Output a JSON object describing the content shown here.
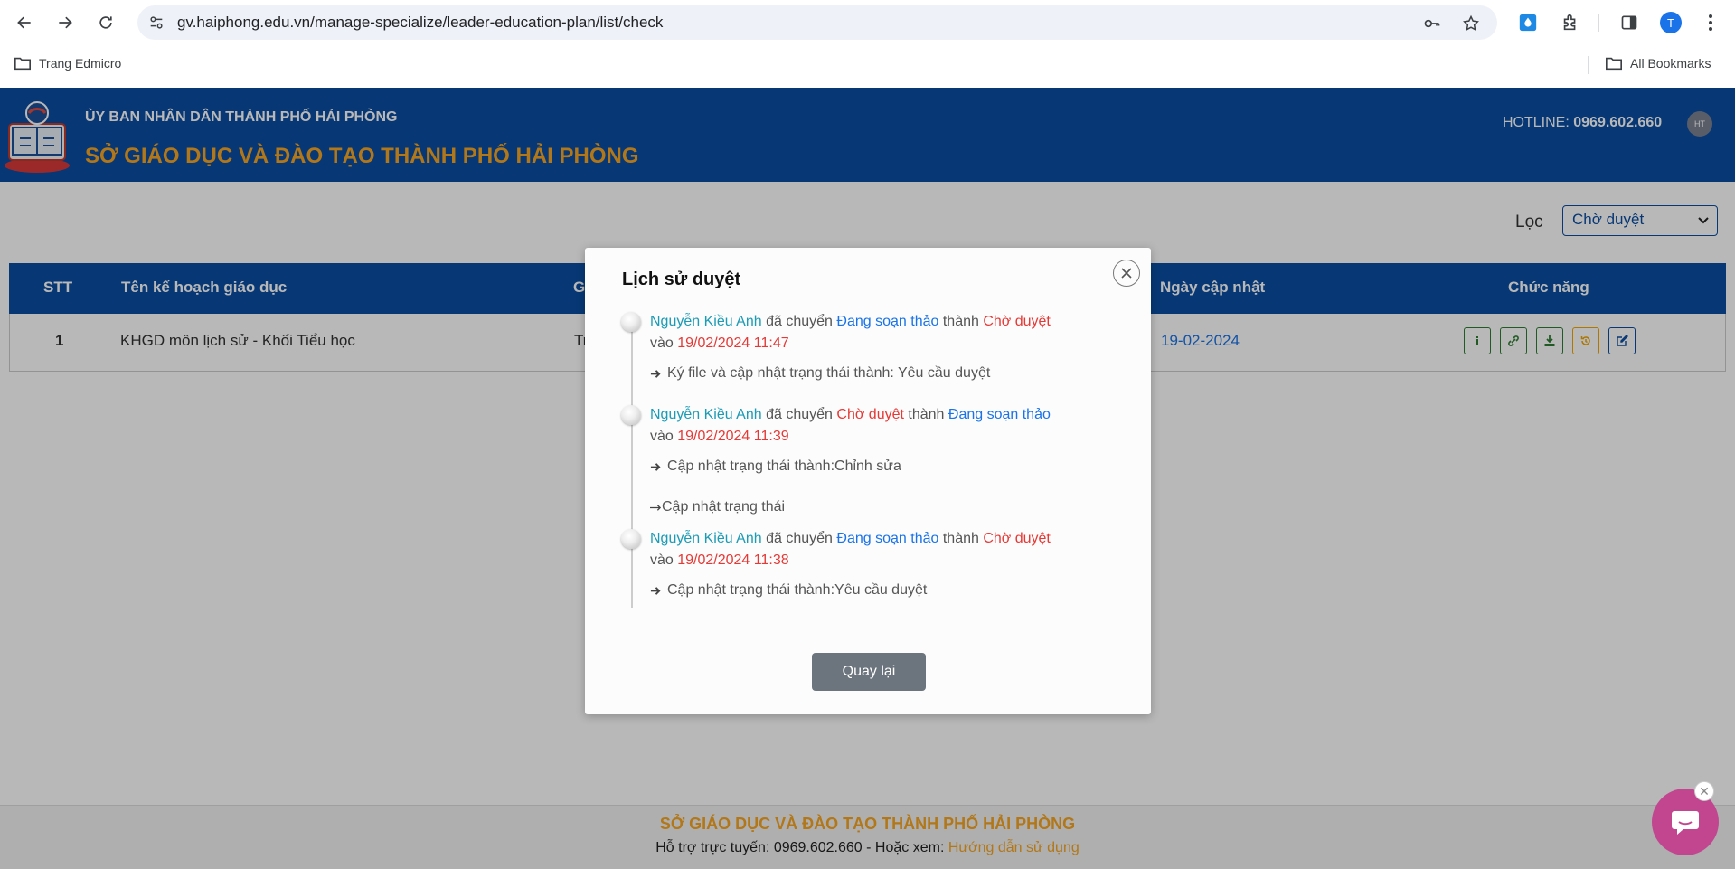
{
  "browser": {
    "url": "gv.haiphong.edu.vn/manage-specialize/leader-education-plan/list/check",
    "profile_initial": "T",
    "bookmarks": [
      {
        "label": "Trang Edmicro"
      }
    ],
    "all_bookmarks_label": "All Bookmarks"
  },
  "header": {
    "line1": "ỦY BAN NHÂN DÂN THÀNH PHỐ HẢI PHÒNG",
    "line2": "SỞ GIÁO DỤC VÀ ĐÀO TẠO THÀNH PHỐ HẢI PHÒNG",
    "hotline_label": "HOTLINE:",
    "hotline_number": "0969.602.660",
    "avatar_initials": "HT"
  },
  "filter": {
    "label": "Lọc",
    "selected": "Chờ duyệt"
  },
  "table": {
    "columns": [
      "STT",
      "Tên kế hoạch giáo dục",
      "G",
      "Ngày cập nhật",
      "Chức năng"
    ],
    "rows": [
      {
        "stt": "1",
        "name": "KHGD môn lịch sử - Khối Tiểu học",
        "partial": "Tr",
        "updated": "19-02-2024"
      }
    ]
  },
  "footer": {
    "title": "SỞ GIÁO DỤC VÀ ĐÀO TẠO THÀNH PHỐ HẢI PHÒNG",
    "support_text": "Hỗ trợ trực tuyến: 0969.602.660 - Hoặc xem:",
    "guide_link": "Hướng dẫn sử dụng"
  },
  "modal": {
    "title": "Lịch sử duyệt",
    "entries": [
      {
        "user": "Nguyễn Kiều Anh",
        "verb": "đã chuyển",
        "from": "Đang soạn thảo",
        "mid": "thành",
        "to": "Chờ duyệt",
        "at_label": "vào",
        "time": "19/02/2024 11:47",
        "notes": [
          "Ký file và cập nhật trạng thái thành: Yêu cầu duyệt"
        ]
      },
      {
        "user": "Nguyễn Kiều Anh",
        "verb": "đã chuyển",
        "from": "Chờ duyệt",
        "mid": "thành",
        "to": "Đang soạn thảo",
        "at_label": "vào",
        "time": "19/02/2024 11:39",
        "notes": [
          "Cập nhật trạng thái thành:Chỉnh sửa",
          "Cập nhật trạng thái"
        ]
      },
      {
        "user": "Nguyễn Kiều Anh",
        "verb": "đã chuyển",
        "from": "Đang soạn thảo",
        "mid": "thành",
        "to": "Chờ duyệt",
        "at_label": "vào",
        "time": "19/02/2024 11:38",
        "notes": [
          "Cập nhật trạng thái thành:Yêu cầu duyệt"
        ]
      }
    ],
    "back_button": "Quay lại"
  },
  "colors": {
    "brand_blue": "#0b4ea2",
    "accent_orange": "#f5a623",
    "status_red": "#e53935",
    "status_blue": "#1a73e8",
    "user_teal": "#1b9bb5",
    "chat_purple": "#c2468f"
  }
}
